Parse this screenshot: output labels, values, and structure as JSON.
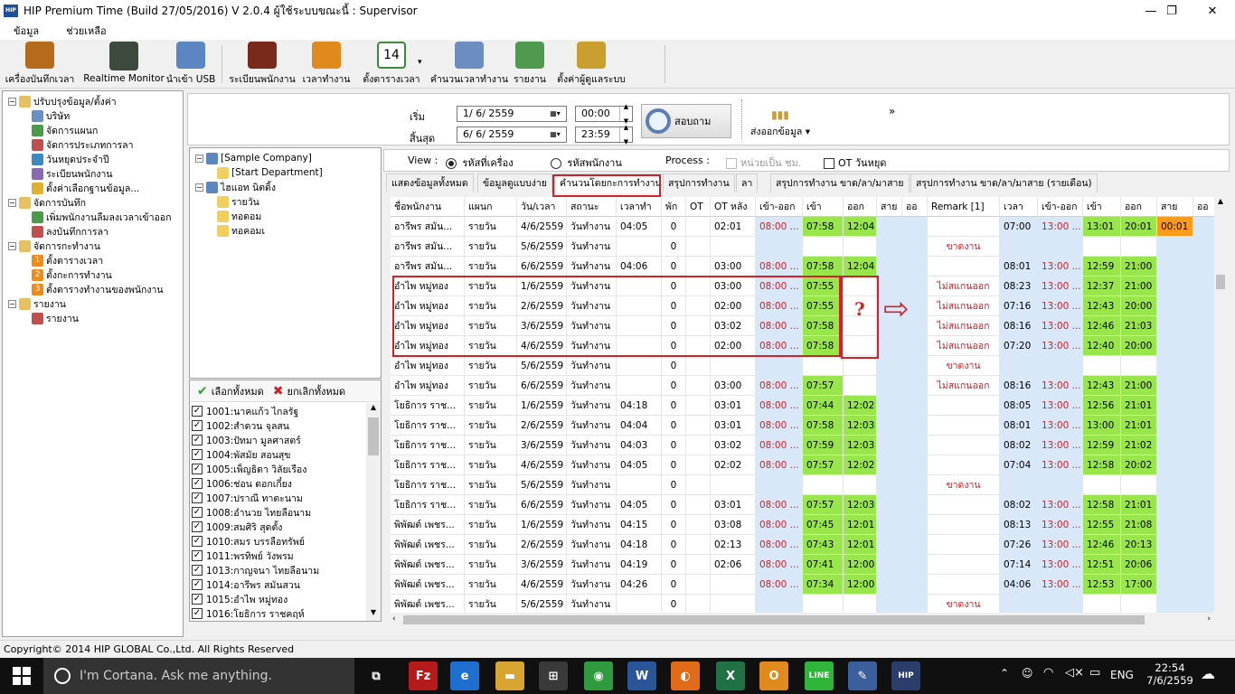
{
  "window": {
    "title": "HIP Premium Time (Build 27/05/2016) V 2.0.4   ผู้ใช้ระบบขณะนี้ : Supervisor",
    "icon_text": "HIP"
  },
  "menu": [
    "ข้อมูล",
    "ช่วยเหลือ"
  ],
  "toolbar": [
    {
      "label": "เครื่องบันทึกเวลา",
      "icon": "clock-icon",
      "color": "#b56a1c"
    },
    {
      "label": "Realtime Monitor",
      "icon": "monitor-icon",
      "color": "#3f4a3f"
    },
    {
      "label": "นำเข้า USB",
      "icon": "usb-icon",
      "color": "#5b86c2"
    },
    {
      "label": "ระเบียนพนักงาน",
      "icon": "people-icon",
      "color": "#7a2a1a"
    },
    {
      "label": "เวลาทำงาน",
      "icon": "stopwatch-icon",
      "color": "#e08a1e"
    },
    {
      "label": "ตั้งตารางเวลา",
      "icon": "calendar-icon",
      "color": "#3c8a3c",
      "icon_text": "14"
    },
    {
      "label": "คำนวนเวลาทำงาน",
      "icon": "calculate-icon",
      "color": "#6b8dbf"
    },
    {
      "label": "รายงาน",
      "icon": "report-icon",
      "color": "#4f9a4f"
    },
    {
      "label": "ตั้งค่าผู้ดูแลระบบ",
      "icon": "settings-icon",
      "color": "#c9a030"
    }
  ],
  "left_tree": [
    {
      "label": "ปรับปรุงข้อมูล/ตั้งค่า",
      "level": 0,
      "icon": "folder-settings-icon",
      "expand": "−"
    },
    {
      "label": "บริษัท",
      "level": 1,
      "icon": "company-icon"
    },
    {
      "label": "จัดการแผนก",
      "level": 1,
      "icon": "department-icon"
    },
    {
      "label": "จัดการประเภทการลา",
      "level": 1,
      "icon": "leave-type-icon"
    },
    {
      "label": "วันหยุดประจำปี",
      "level": 1,
      "icon": "holiday-icon"
    },
    {
      "label": "ระเบียนพนักงาน",
      "level": 1,
      "icon": "employee-icon"
    },
    {
      "label": "ตั้งค่าเลือกฐานข้อมูล...",
      "level": 1,
      "icon": "database-icon"
    },
    {
      "label": "จัดการบันทึก",
      "level": 0,
      "icon": "folder-record-icon",
      "expand": "−"
    },
    {
      "label": "เพิ่มพนักงานลืมลงเวลาเข้าออก",
      "level": 1,
      "icon": "add-time-icon"
    },
    {
      "label": "ลงบันทึกการลา",
      "level": 1,
      "icon": "leave-record-icon"
    },
    {
      "label": "จัดการกะทำงาน",
      "level": 0,
      "icon": "folder-shift-icon",
      "expand": "−"
    },
    {
      "label": "ตั้งตารางเวลา",
      "level": 1,
      "icon": "step-1-icon",
      "badge": "1"
    },
    {
      "label": "ตั้งกะการทำงาน",
      "level": 1,
      "icon": "step-2-icon",
      "badge": "2"
    },
    {
      "label": "ตั้งตารางทำงานของพนักงาน",
      "level": 1,
      "icon": "step-3-icon",
      "badge": "3"
    },
    {
      "label": "รายงาน",
      "level": 0,
      "icon": "folder-report-icon",
      "expand": "−"
    },
    {
      "label": "รายงาน",
      "level": 1,
      "icon": "bar-chart-icon"
    }
  ],
  "filter": {
    "start_label": "เริ่ม",
    "end_label": "สิ้นสุด",
    "start_date": "1/  6/  2559",
    "end_date": "6/  6/  2559",
    "start_time": "00:00",
    "end_time": "23:59",
    "search_label": "สอบถาม",
    "export_label": "ส่งออกข้อมูล",
    "more": "»"
  },
  "company_tree": [
    {
      "label": "[Sample Company]",
      "level": 0,
      "expand": "−"
    },
    {
      "label": "[Start Department]",
      "level": 1
    },
    {
      "label": "ไฮแอท นิตดิ้ง",
      "level": 0,
      "expand": "−"
    },
    {
      "label": "รายวัน",
      "level": 1
    },
    {
      "label": "ทอดอม",
      "level": 1
    },
    {
      "label": "ทอคอมเ",
      "level": 1
    }
  ],
  "employee_list": {
    "select_all": "เลือกทั้งหมด",
    "deselect_all": "ยกเลิกทั้งหมด",
    "items": [
      "1001:นาคแก้ว  ไกลรัฐ",
      "1002:สำดวน  จุลสน",
      "1003:ปัทมา  มูลศาสตร์",
      "1004:พัสมัย  สอนสุข",
      "1005:เพ็ญธิดา  วิลัยเรือง",
      "1006:ช่อน ดอกเกี๋ยง",
      "1007:ปราณี  ทาตะนาม",
      "1008:อำนวย  ไทยลือนาม",
      "1009:สมศิริ  สุดตั้ง",
      "1010:สมร  บรรลือทรัพย์",
      "1011:พรทิพย์  วังพรม",
      "1013:กาญจนา  ไทยลือนาม",
      "1014:อารีพร  สมันสวน",
      "1015:อำไพ  หมู่ทอง",
      "1016:โยธิการ ราชคฤห์"
    ]
  },
  "view": {
    "label": "View :",
    "option1": "รหัสที่เครื่อง",
    "option2": "รหัสพนักงาน",
    "process_label": "Process :",
    "unit_hour": "หน่วยเป็น ชม.",
    "ot_holiday": "OT วันหยุด"
  },
  "tabs": [
    "แสดงข้อมูลทั้งหมด",
    "ข้อมูลดูแบบง่าย",
    "คำนวนโดยกะการทำงาน",
    "สรุปการทำงาน",
    "ลา",
    "สรุปการทำงาน ขาด/ลา/มาสาย",
    "สรุปการทำงาน ขาด/ลา/มาสาย (รายเดือน)"
  ],
  "active_tab": 2,
  "grid": {
    "headers": [
      "ชื่อพนักงาน",
      "แผนก",
      "วัน/เวลา",
      "สถานะ",
      "เวลาทำ",
      "พัก",
      "OT",
      "OT หลัง",
      "เข้า-ออก",
      "เข้า",
      "ออก",
      "สาย",
      "ออ",
      "Remark [1]",
      "เวลา",
      "เข้า-ออก",
      "เข้า",
      "ออก",
      "สาย",
      "ออ"
    ],
    "rows": [
      [
        "อารีพร  สมัน...",
        "รายวัน",
        "4/6/2559",
        "วันทำงาน",
        "04:05",
        "0",
        "",
        "02:01",
        "08:00 ...",
        "07:58",
        "12:04",
        "",
        "",
        "",
        "07:00",
        "13:00 ...",
        "13:01",
        "20:01",
        "00:01",
        ""
      ],
      [
        "อารีพร  สมัน...",
        "รายวัน",
        "5/6/2559",
        "วันทำงาน",
        "",
        "0",
        "",
        "",
        "",
        "",
        "",
        "",
        "",
        "ขาดงาน",
        "",
        "",
        "",
        "",
        "",
        ""
      ],
      [
        "อารีพร  สมัน...",
        "รายวัน",
        "6/6/2559",
        "วันทำงาน",
        "04:06",
        "0",
        "",
        "03:00",
        "08:00 ...",
        "07:58",
        "12:04",
        "",
        "",
        "",
        "08:01",
        "13:00 ...",
        "12:59",
        "21:00",
        "",
        ""
      ],
      [
        "อำไพ  หมู่ทอง",
        "รายวัน",
        "1/6/2559",
        "วันทำงาน",
        "",
        "0",
        "",
        "03:00",
        "08:00 ...",
        "07:55",
        "",
        "",
        "",
        "ไม่สแกนออก",
        "08:23",
        "13:00 ...",
        "12:37",
        "21:00",
        "",
        ""
      ],
      [
        "อำไพ  หมู่ทอง",
        "รายวัน",
        "2/6/2559",
        "วันทำงาน",
        "",
        "0",
        "",
        "02:00",
        "08:00 ...",
        "07:55",
        "",
        "",
        "",
        "ไม่สแกนออก",
        "07:16",
        "13:00 ...",
        "12:43",
        "20:00",
        "",
        ""
      ],
      [
        "อำไพ  หมู่ทอง",
        "รายวัน",
        "3/6/2559",
        "วันทำงาน",
        "",
        "0",
        "",
        "03:02",
        "08:00 ...",
        "07:58",
        "",
        "",
        "",
        "ไม่สแกนออก",
        "08:16",
        "13:00 ...",
        "12:46",
        "21:03",
        "",
        ""
      ],
      [
        "อำไพ  หมู่ทอง",
        "รายวัน",
        "4/6/2559",
        "วันทำงาน",
        "",
        "0",
        "",
        "02:00",
        "08:00 ...",
        "07:58",
        "",
        "",
        "",
        "ไม่สแกนออก",
        "07:20",
        "13:00 ...",
        "12:40",
        "20:00",
        "",
        ""
      ],
      [
        "อำไพ  หมู่ทอง",
        "รายวัน",
        "5/6/2559",
        "วันทำงาน",
        "",
        "0",
        "",
        "",
        "",
        "",
        "",
        "",
        "",
        "ขาดงาน",
        "",
        "",
        "",
        "",
        "",
        ""
      ],
      [
        "อำไพ  หมู่ทอง",
        "รายวัน",
        "6/6/2559",
        "วันทำงาน",
        "",
        "0",
        "",
        "03:00",
        "08:00 ...",
        "07:57",
        "",
        "",
        "",
        "ไม่สแกนออก",
        "08:16",
        "13:00 ...",
        "12:43",
        "21:00",
        "",
        ""
      ],
      [
        "โยธิการ ราช...",
        "รายวัน",
        "1/6/2559",
        "วันทำงาน",
        "04:18",
        "0",
        "",
        "03:01",
        "08:00 ...",
        "07:44",
        "12:02",
        "",
        "",
        "",
        "08:05",
        "13:00 ...",
        "12:56",
        "21:01",
        "",
        ""
      ],
      [
        "โยธิการ ราช...",
        "รายวัน",
        "2/6/2559",
        "วันทำงาน",
        "04:04",
        "0",
        "",
        "03:01",
        "08:00 ...",
        "07:58",
        "12:03",
        "",
        "",
        "",
        "08:01",
        "13:00 ...",
        "13:00",
        "21:01",
        "",
        ""
      ],
      [
        "โยธิการ ราช...",
        "รายวัน",
        "3/6/2559",
        "วันทำงาน",
        "04:03",
        "0",
        "",
        "03:02",
        "08:00 ...",
        "07:59",
        "12:03",
        "",
        "",
        "",
        "08:02",
        "13:00 ...",
        "12:59",
        "21:02",
        "",
        ""
      ],
      [
        "โยธิการ ราช...",
        "รายวัน",
        "4/6/2559",
        "วันทำงาน",
        "04:05",
        "0",
        "",
        "02:02",
        "08:00 ...",
        "07:57",
        "12:02",
        "",
        "",
        "",
        "07:04",
        "13:00 ...",
        "12:58",
        "20:02",
        "",
        ""
      ],
      [
        "โยธิการ ราช...",
        "รายวัน",
        "5/6/2559",
        "วันทำงาน",
        "",
        "0",
        "",
        "",
        "",
        "",
        "",
        "",
        "",
        "ขาดงาน",
        "",
        "",
        "",
        "",
        "",
        ""
      ],
      [
        "โยธิการ ราช...",
        "รายวัน",
        "6/6/2559",
        "วันทำงาน",
        "04:05",
        "0",
        "",
        "03:01",
        "08:00 ...",
        "07:57",
        "12:03",
        "",
        "",
        "",
        "08:02",
        "13:00 ...",
        "12:58",
        "21:01",
        "",
        ""
      ],
      [
        "พิพัฒต์ เพชร...",
        "รายวัน",
        "1/6/2559",
        "วันทำงาน",
        "04:15",
        "0",
        "",
        "03:08",
        "08:00 ...",
        "07:45",
        "12:01",
        "",
        "",
        "",
        "08:13",
        "13:00 ...",
        "12:55",
        "21:08",
        "",
        ""
      ],
      [
        "พิพัฒต์ เพชร...",
        "รายวัน",
        "2/6/2559",
        "วันทำงาน",
        "04:18",
        "0",
        "",
        "02:13",
        "08:00 ...",
        "07:43",
        "12:01",
        "",
        "",
        "",
        "07:26",
        "13:00 ...",
        "12:46",
        "20:13",
        "",
        ""
      ],
      [
        "พิพัฒต์ เพชร...",
        "รายวัน",
        "3/6/2559",
        "วันทำงาน",
        "04:19",
        "0",
        "",
        "02:06",
        "08:00 ...",
        "07:41",
        "12:00",
        "",
        "",
        "",
        "07:14",
        "13:00 ...",
        "12:51",
        "20:06",
        "",
        ""
      ],
      [
        "พิพัฒต์ เพชร...",
        "รายวัน",
        "4/6/2559",
        "วันทำงาน",
        "04:26",
        "0",
        "",
        "",
        "08:00 ...",
        "07:34",
        "12:00",
        "",
        "",
        "",
        "04:06",
        "13:00 ...",
        "12:53",
        "17:00",
        "",
        ""
      ],
      [
        "พิพัฒต์ เพชร...",
        "รายวัน",
        "5/6/2559",
        "วันทำงาน",
        "",
        "0",
        "",
        "",
        "",
        "",
        "",
        "",
        "",
        "ขาดงาน",
        "",
        "",
        "",
        "",
        "",
        ""
      ]
    ]
  },
  "annotation": {
    "question_mark": "?",
    "arrow": "⇨"
  },
  "status_text": "Copyright© 2014 HIP GLOBAL Co.,Ltd. All Rights Reserved",
  "taskbar": {
    "search_placeholder": "I'm Cortana. Ask me anything.",
    "lang": "ENG",
    "time": "22:54",
    "date": "7/6/2559",
    "apps": [
      {
        "name": "task-view-icon",
        "text": "⧉",
        "color": "#101010"
      },
      {
        "name": "filezilla-icon",
        "text": "Fz",
        "color": "#b51b1b"
      },
      {
        "name": "edge-icon",
        "text": "e",
        "color": "#1e6fd0"
      },
      {
        "name": "file-explorer-icon",
        "text": "▬",
        "color": "#d8a630"
      },
      {
        "name": "store-icon",
        "text": "⊞",
        "color": "#3a3a3a"
      },
      {
        "name": "chrome-icon",
        "text": "◉",
        "color": "#2f9a3e"
      },
      {
        "name": "word-icon",
        "text": "W",
        "color": "#2a5599"
      },
      {
        "name": "firefox-icon",
        "text": "◐",
        "color": "#e26b1a"
      },
      {
        "name": "excel-icon",
        "text": "X",
        "color": "#207245"
      },
      {
        "name": "outlook-icon",
        "text": "O",
        "color": "#e08a1e"
      },
      {
        "name": "line-icon",
        "text": "LINE",
        "color": "#2fb53a"
      },
      {
        "name": "paint-icon",
        "text": "✎",
        "color": "#3b5e9c"
      },
      {
        "name": "hip-time-icon",
        "text": "HIP",
        "color": "#2a3d6b"
      }
    ]
  },
  "colors": {
    "green_cell": "#99e64c",
    "blue_col": "#d8e8f8",
    "red_text": "#d42027",
    "orange_cell": "#ff9a1a",
    "selection_box": "#d42027"
  }
}
